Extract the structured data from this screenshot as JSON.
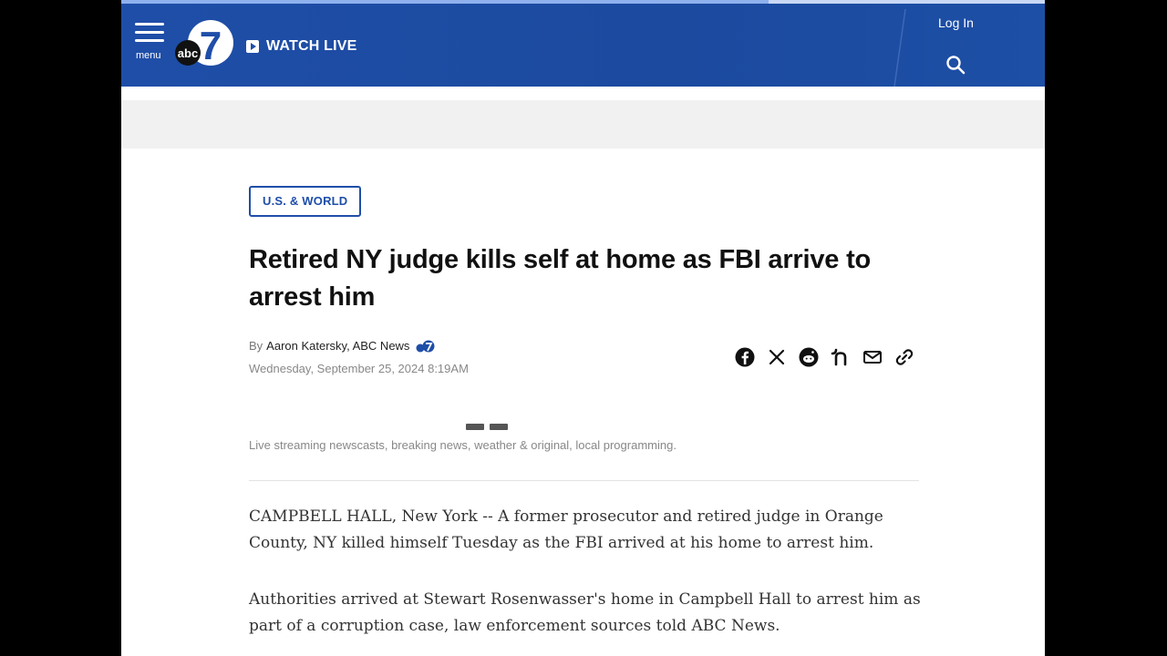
{
  "header": {
    "menu_label": "menu",
    "logo_text": "abc",
    "channel_number": "7",
    "watch_live_label": "WATCH LIVE",
    "login_label": "Log In",
    "brand_color": "#1f4ea8"
  },
  "article": {
    "category": "U.S. & WORLD",
    "headline": "Retired NY judge kills self at home as FBI arrive to arrest him",
    "byline_prefix": "By",
    "author": "Aaron Katersky, ABC News",
    "date": "Wednesday, September 25, 2024 8:19AM",
    "player_caption": "Live streaming newscasts, breaking news, weather & original, local programming.",
    "paragraphs": [
      "CAMPBELL HALL, New York -- A former prosecutor and retired judge in Orange County, NY killed himself Tuesday as the FBI arrived at his home to arrest him.",
      "Authorities arrived at Stewart Rosenwasser's home in Campbell Hall to arrest him as part of a corruption case, law enforcement sources told ABC News."
    ]
  },
  "share_icons": [
    "facebook-icon",
    "x-icon",
    "reddit-icon",
    "nextdoor-icon",
    "email-icon",
    "link-icon"
  ]
}
